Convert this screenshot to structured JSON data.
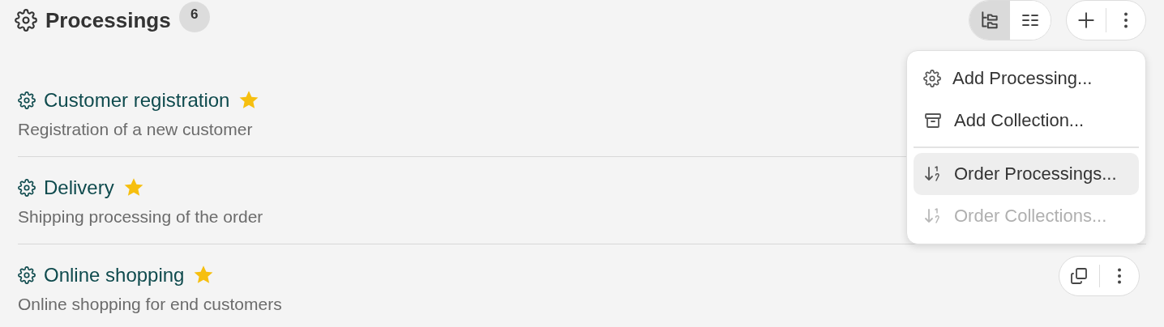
{
  "header": {
    "title": "Processings",
    "count": "6"
  },
  "view_modes": [
    {
      "kind": "tree",
      "selected": true
    },
    {
      "kind": "list",
      "selected": false
    }
  ],
  "menu": {
    "sections": [
      [
        {
          "kind": "gear",
          "label": "Add Processing...",
          "highlighted": false,
          "disabled": false
        },
        {
          "kind": "archive",
          "label": "Add Collection...",
          "highlighted": false,
          "disabled": false
        }
      ],
      [
        {
          "kind": "sort",
          "label": "Order Processings...",
          "highlighted": true,
          "disabled": false
        },
        {
          "kind": "sort",
          "label": "Order Collections...",
          "highlighted": false,
          "disabled": true
        }
      ]
    ]
  },
  "processings": [
    {
      "title": "Customer registration",
      "description": "Registration of a new customer",
      "favorite": true,
      "actions_shown": false
    },
    {
      "title": "Delivery",
      "description": "Shipping processing of the order",
      "favorite": true,
      "actions_shown": false
    },
    {
      "title": "Online shopping",
      "description": "Online shopping for end customers",
      "favorite": true,
      "actions_shown": true
    }
  ]
}
